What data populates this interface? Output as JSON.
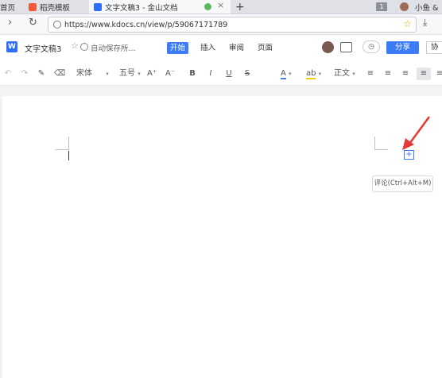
{
  "tabs": [
    {
      "label": "首页"
    },
    {
      "label": "稻壳模板"
    },
    {
      "label": "文字文稿3 - 金山文档"
    }
  ],
  "tab_bar": {
    "new_tab": "+",
    "badge": "1",
    "user": "小鱼 &"
  },
  "address": {
    "url": "https://www.kdocs.cn/view/p/59067171789"
  },
  "header": {
    "doc_title": "文字文稿3",
    "autosave": "自动保存所...",
    "menus": [
      "开始",
      "插入",
      "审阅",
      "页面"
    ],
    "share_label": "分享",
    "collab_label": "协"
  },
  "toolbar": {
    "font_name": "宋体",
    "font_size": "五号",
    "grow": "A⁺",
    "shrink": "A⁻",
    "bold": "B",
    "italic": "I",
    "underline": "U",
    "strike": "S",
    "font_color": "A",
    "highlight": "ab",
    "style": "正文"
  },
  "comment": {
    "plus": "+",
    "tooltip": "评论(Ctrl+Alt+M)"
  },
  "colors": {
    "accent": "#3c7cf6",
    "arrow": "#e53935"
  }
}
